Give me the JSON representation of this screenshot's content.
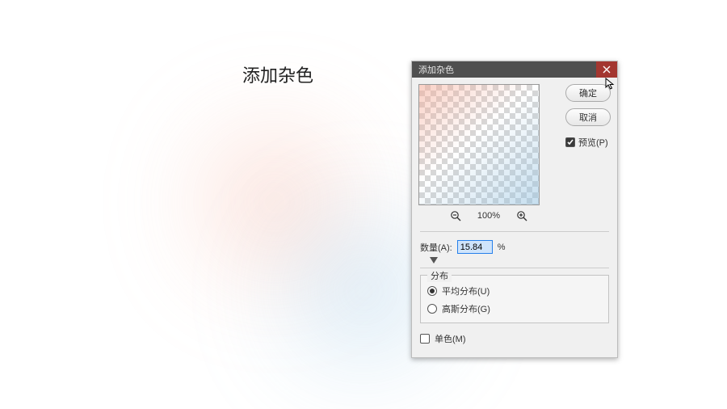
{
  "heading": "添加杂色",
  "dialog": {
    "title": "添加杂色",
    "ok": "确定",
    "cancel": "取消",
    "preview_label": "预览(P)",
    "preview_checked": true,
    "zoom": "100%",
    "amount_label": "数量(A):",
    "amount_value": "15.84",
    "amount_unit": "%",
    "distribution_legend": "分布",
    "uniform_label": "平均分布(U)",
    "gaussian_label": "高斯分布(G)",
    "distribution_selected": "uniform",
    "mono_label": "单色(M)",
    "mono_checked": false
  }
}
